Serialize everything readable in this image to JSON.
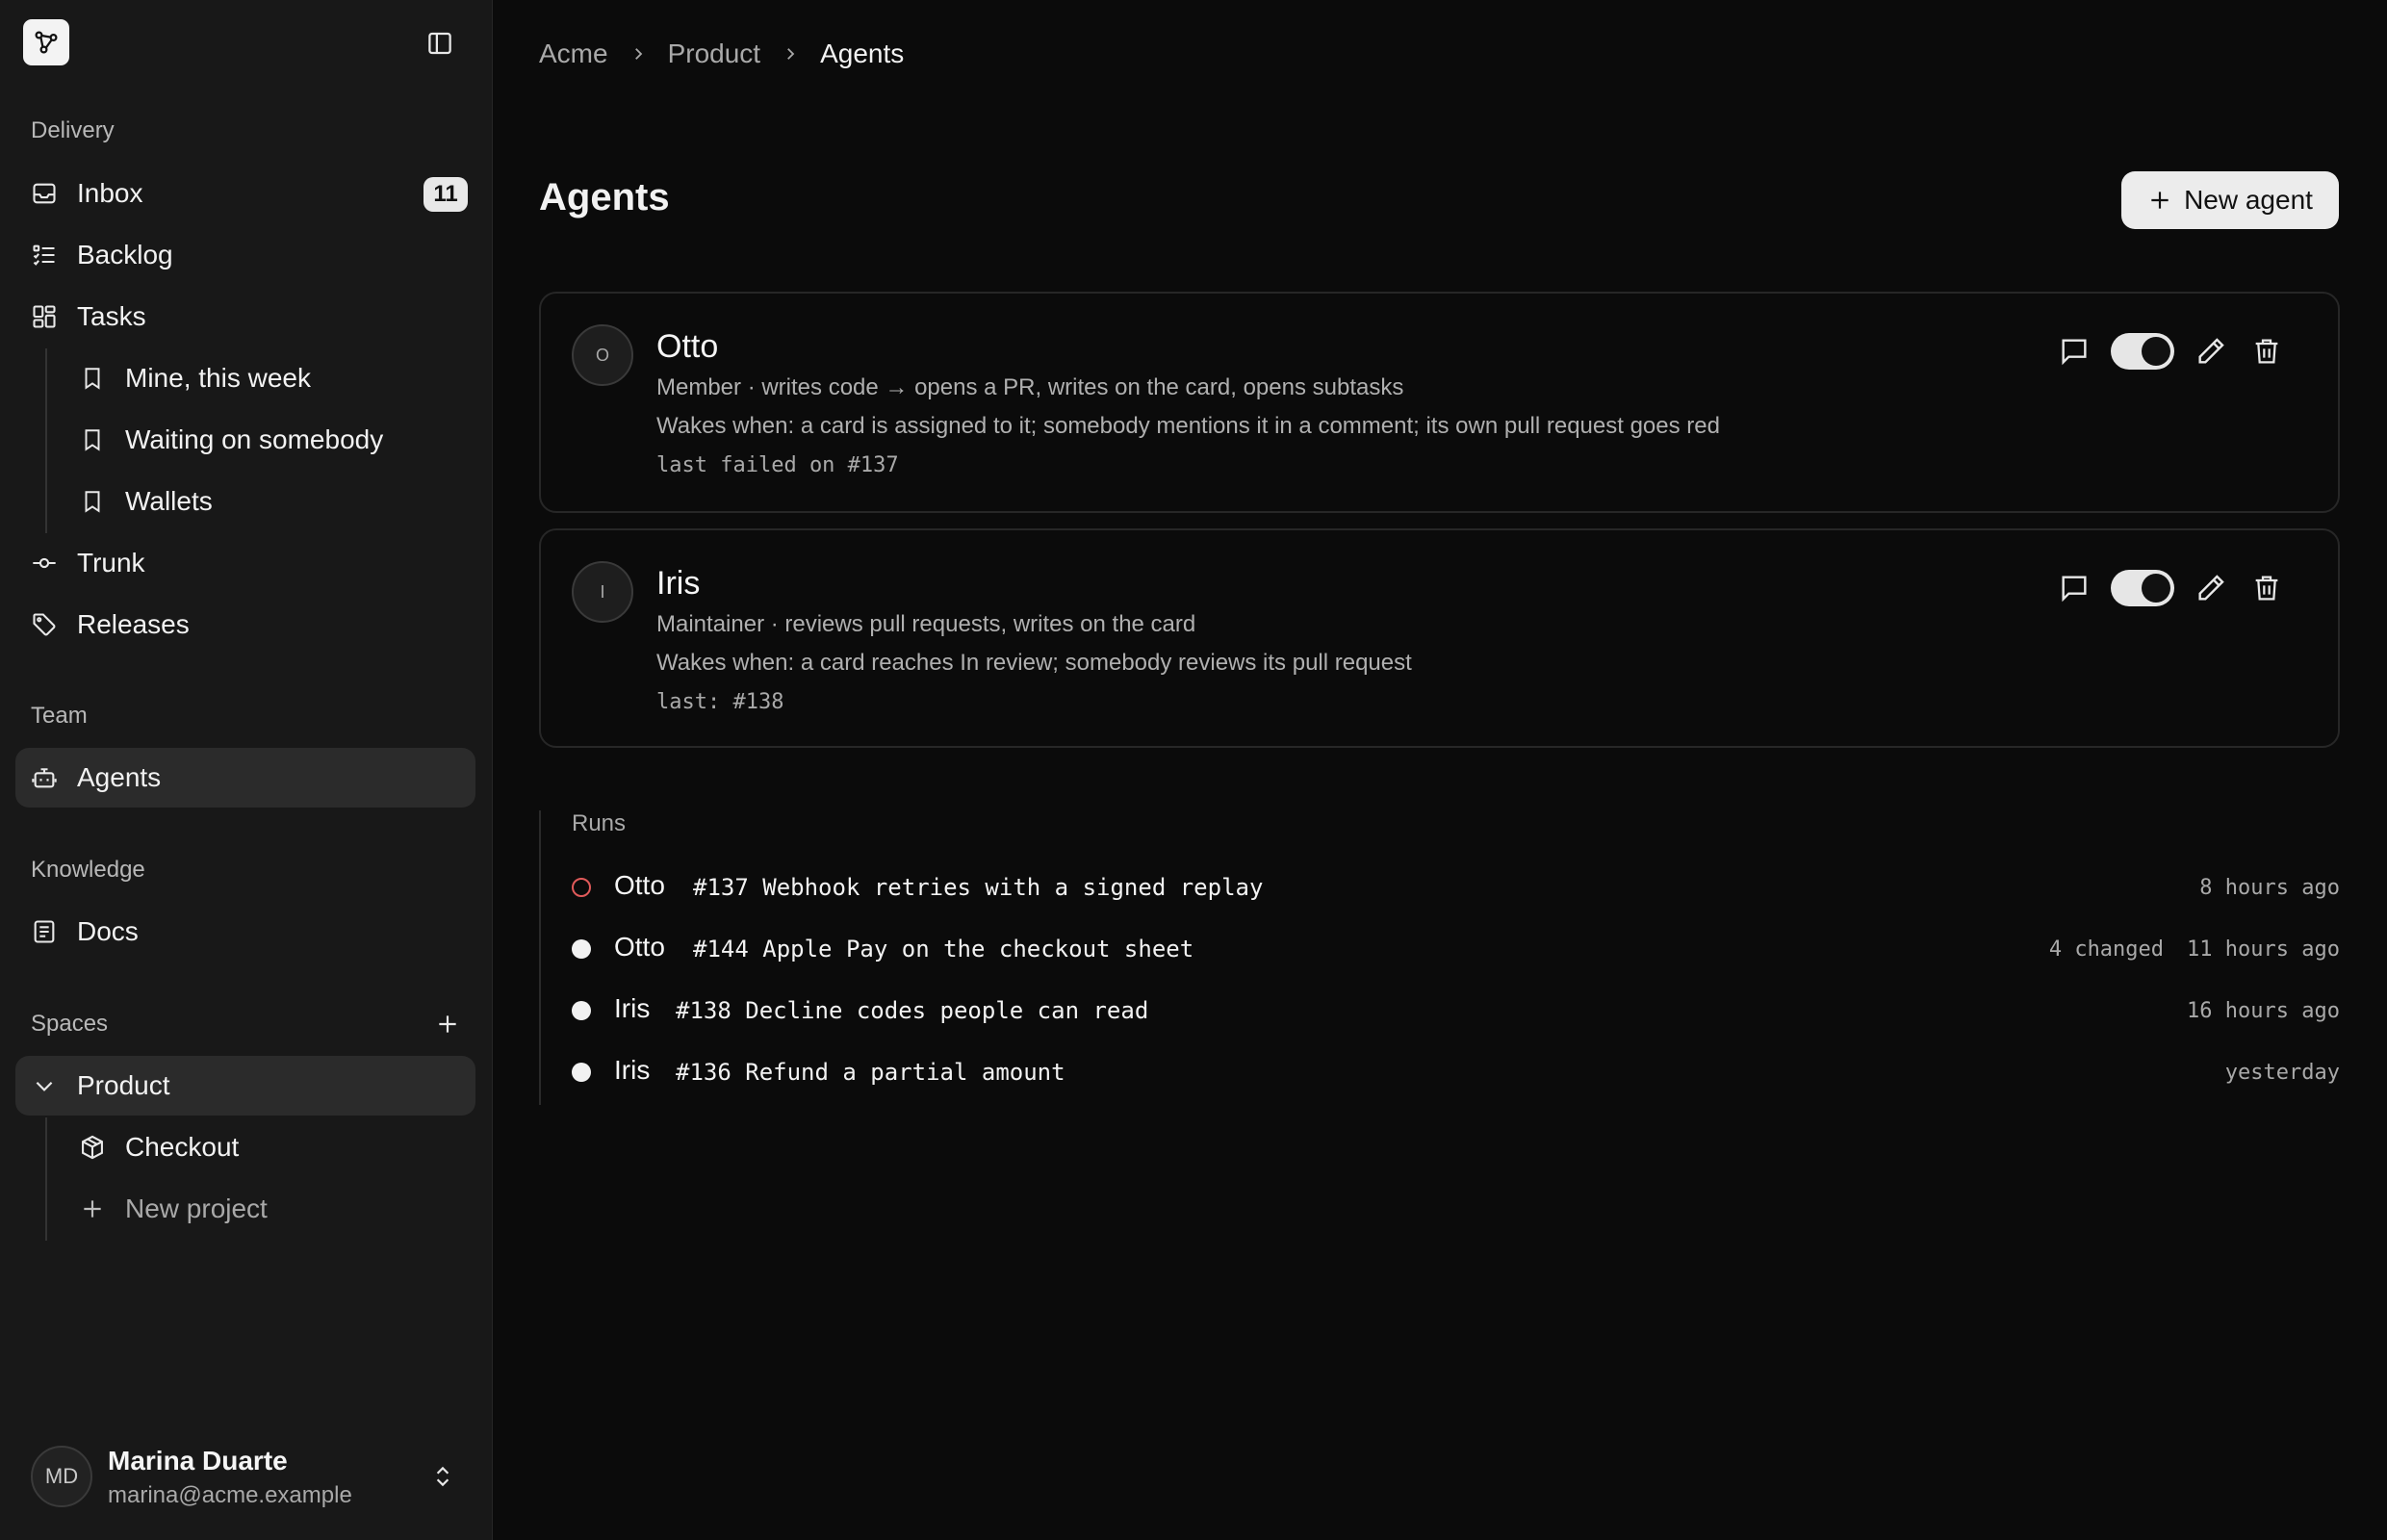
{
  "sidebar": {
    "sections": {
      "delivery": "Delivery",
      "team": "Team",
      "knowledge": "Knowledge",
      "spaces": "Spaces"
    },
    "items": {
      "inbox": {
        "label": "Inbox",
        "badge": "11"
      },
      "backlog": {
        "label": "Backlog"
      },
      "tasks": {
        "label": "Tasks"
      },
      "mine_week": {
        "label": "Mine, this week"
      },
      "waiting": {
        "label": "Waiting on somebody"
      },
      "wallets": {
        "label": "Wallets"
      },
      "trunk": {
        "label": "Trunk"
      },
      "releases": {
        "label": "Releases"
      },
      "agents": {
        "label": "Agents"
      },
      "docs": {
        "label": "Docs"
      },
      "product": {
        "label": "Product"
      },
      "checkout": {
        "label": "Checkout"
      },
      "new_project": {
        "label": "New project"
      }
    },
    "user": {
      "initials": "MD",
      "name": "Marina Duarte",
      "email": "marina@acme.example"
    }
  },
  "breadcrumb": [
    "Acme",
    "Product",
    "Agents"
  ],
  "header": {
    "title": "Agents",
    "new_agent_label": "New agent"
  },
  "agents": [
    {
      "initial": "O",
      "name": "Otto",
      "role": "Member · writes code → opens a PR, writes on the card, opens subtasks",
      "wakes": "Wakes when: a card is assigned to it; somebody mentions it in a comment; its own pull request goes red",
      "last": "last failed on #137",
      "enabled": true
    },
    {
      "initial": "I",
      "name": "Iris",
      "role": "Maintainer · reviews pull requests, writes on the card",
      "wakes": "Wakes when: a card reaches In review; somebody reviews its pull request",
      "last": "last: #138",
      "enabled": true
    }
  ],
  "runs": {
    "label": "Runs",
    "items": [
      {
        "agent": "Otto",
        "title": "#137 Webhook retries with a signed replay",
        "changed": "",
        "time": "8 hours ago",
        "status": "failed"
      },
      {
        "agent": "Otto",
        "title": "#144 Apple Pay on the checkout sheet",
        "changed": "4 changed",
        "time": "11 hours ago",
        "status": "done"
      },
      {
        "agent": "Iris",
        "title": "#138 Decline codes people can read",
        "changed": "",
        "time": "16 hours ago",
        "status": "done"
      },
      {
        "agent": "Iris",
        "title": "#136 Refund a partial amount",
        "changed": "",
        "time": "yesterday",
        "status": "done"
      }
    ]
  },
  "colors": {
    "background": "#0b0b0b",
    "sidebar": "#181818",
    "failed": "#e05a5a"
  }
}
